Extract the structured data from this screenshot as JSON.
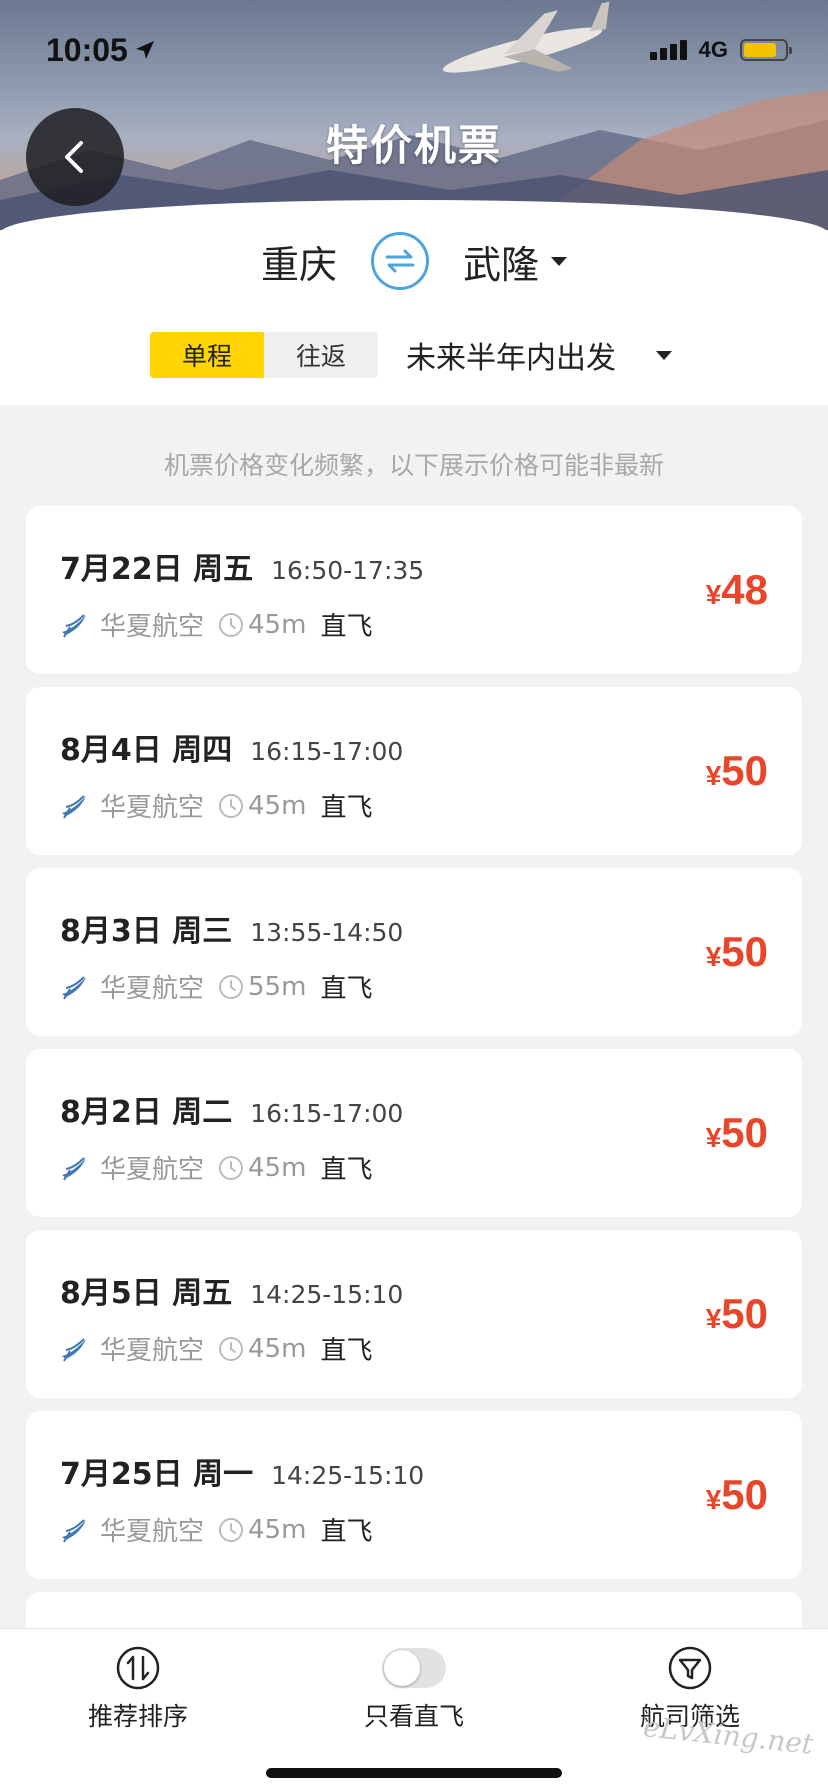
{
  "status_bar": {
    "time": "10:05",
    "network": "4G",
    "battery_level": 0.8
  },
  "header": {
    "title": "特价机票"
  },
  "route": {
    "origin": "重庆",
    "destination": "武隆"
  },
  "trip_type": {
    "options": [
      "单程",
      "往返"
    ],
    "selected": "单程"
  },
  "date_range": {
    "label": "未来半年内出发"
  },
  "notice": "机票价格变化频繁，以下展示价格可能非最新",
  "flights": [
    {
      "date": "7月22日 周五",
      "time": "16:50-17:35",
      "airline": "华夏航空",
      "duration": "45m",
      "type": "直飞",
      "price_symbol": "¥",
      "price": "48"
    },
    {
      "date": "8月4日 周四",
      "time": "16:15-17:00",
      "airline": "华夏航空",
      "duration": "45m",
      "type": "直飞",
      "price_symbol": "¥",
      "price": "50"
    },
    {
      "date": "8月3日 周三",
      "time": "13:55-14:50",
      "airline": "华夏航空",
      "duration": "55m",
      "type": "直飞",
      "price_symbol": "¥",
      "price": "50"
    },
    {
      "date": "8月2日 周二",
      "time": "16:15-17:00",
      "airline": "华夏航空",
      "duration": "45m",
      "type": "直飞",
      "price_symbol": "¥",
      "price": "50"
    },
    {
      "date": "8月5日 周五",
      "time": "14:25-15:10",
      "airline": "华夏航空",
      "duration": "45m",
      "type": "直飞",
      "price_symbol": "¥",
      "price": "50"
    },
    {
      "date": "7月25日 周一",
      "time": "14:25-15:10",
      "airline": "华夏航空",
      "duration": "45m",
      "type": "直飞",
      "price_symbol": "¥",
      "price": "50"
    }
  ],
  "tabbar": {
    "sort": "推荐排序",
    "direct_only": "只看直飞",
    "airline_filter": "航司筛选",
    "direct_only_on": false
  },
  "watermark": "eLvXing.net",
  "colors": {
    "accent_yellow": "#ffd400",
    "price_red": "#e8462b",
    "swap_blue": "#4fa4de"
  }
}
